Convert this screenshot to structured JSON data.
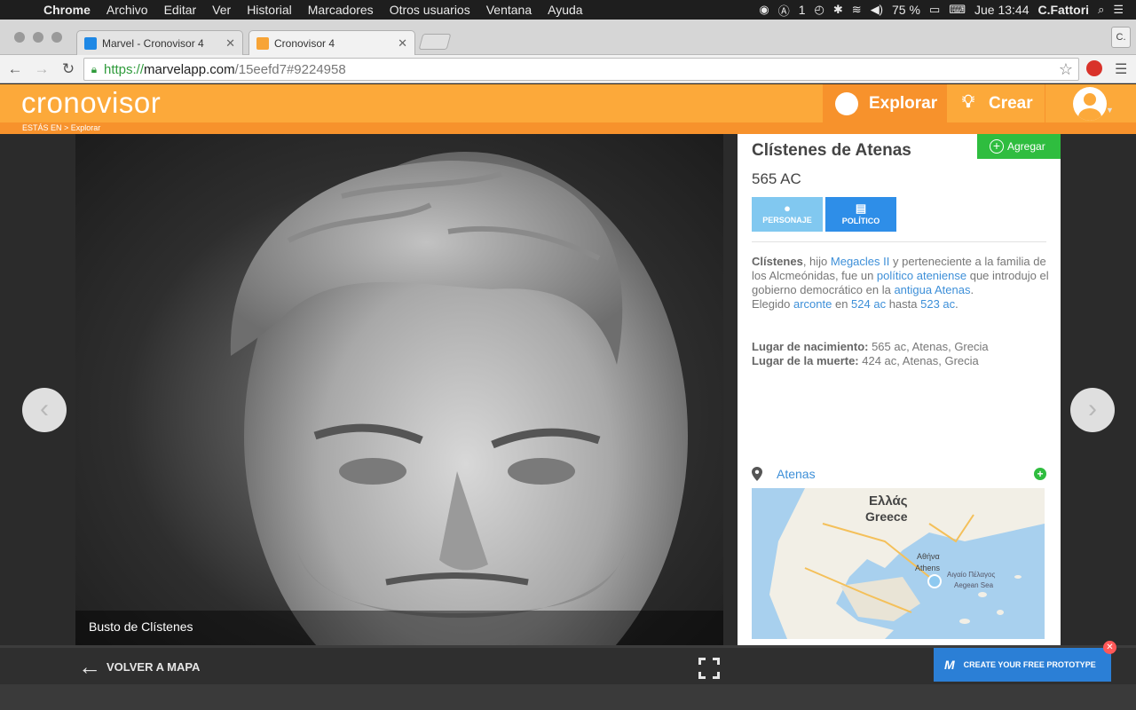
{
  "menubar": {
    "app": "Chrome",
    "items": [
      "Archivo",
      "Editar",
      "Ver",
      "Historial",
      "Marcadores",
      "Otros usuarios",
      "Ventana",
      "Ayuda"
    ],
    "count": "1",
    "battery": "75 %",
    "clock": "Jue 13:44",
    "user": "C.Fattori"
  },
  "browser": {
    "tabs": [
      {
        "title": "Marvel - Cronovisor 4",
        "favicon_color": "#1e88e5"
      },
      {
        "title": "Cronovisor 4",
        "favicon_color": "#f7a436"
      }
    ],
    "profile_initial": "C.",
    "url_protocol": "https://",
    "url_host": "marvelapp.com",
    "url_path": "/15eefd7#9224958"
  },
  "header": {
    "logo": "cronovisor",
    "nav_explore": "Explorar",
    "nav_create": "Crear",
    "breadcrumb": "ESTÁS EN > Explorar"
  },
  "detail": {
    "title": "Clístenes de Atenas",
    "year": "565 AC",
    "add_label": "Agregar",
    "tag_personaje": "PERSONAJE",
    "tag_politico": "POLÍTICO",
    "bio": {
      "name": "Clístenes",
      "t1": ", hijo ",
      "l1": "Megacles II",
      "t2": " y perteneciente a la familia de los Alcmeónidas, fue un ",
      "l2": "político ateniense",
      "t3": " que introdujo el gobierno democrático en la ",
      "l3": "antigua Atenas",
      "t4": ".",
      "t5": "Elegido ",
      "l4": "arconte",
      "t6": " en ",
      "l5": "524 ac",
      "t7": " hasta ",
      "l6": "523 ac",
      "t8": "."
    },
    "birth_label": "Lugar de nacimiento:",
    "birth_value": " 565 ac, Atenas, Grecia",
    "death_label": "Lugar de la muerte:",
    "death_value": " 424 ac, Atenas, Grecia",
    "place": "Atenas",
    "map_labels": {
      "greek": "Ελλάς",
      "greece": "Greece",
      "athina": "Αθήνα",
      "athens": "Athens",
      "aegean_gr": "Αιγαίο Πέλαγος",
      "aegean": "Aegean Sea"
    }
  },
  "media": {
    "caption": "Busto de Clístenes"
  },
  "bottom": {
    "back_label": "VOLVER A MAPA",
    "promo_label": "CREATE YOUR FREE PROTOTYPE"
  },
  "colors": {
    "brand_orange": "#fca93a",
    "brand_orange_dark": "#f7922c",
    "link_blue": "#3d8fd8",
    "add_green": "#2fbd3f",
    "promo_blue": "#2b7fd6"
  }
}
